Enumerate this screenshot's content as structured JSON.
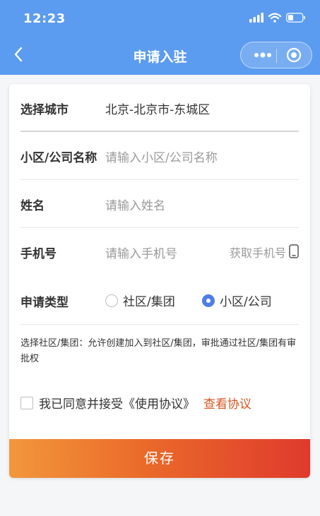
{
  "status": {
    "time": "12:23"
  },
  "nav": {
    "title": "申请入驻"
  },
  "form": {
    "city": {
      "label": "选择城市",
      "value": "北京-北京市-东城区"
    },
    "community": {
      "label": "小区/公司名称",
      "placeholder": "请输入小区/公司名称"
    },
    "name": {
      "label": "姓名",
      "placeholder": "请输入姓名"
    },
    "phone": {
      "label": "手机号",
      "placeholder": "请输入手机号",
      "get_button": "获取手机号"
    },
    "type": {
      "label": "申请类型",
      "options": [
        "社区/集团",
        "小区/公司"
      ],
      "selected": "小区/公司"
    },
    "note": "选择社区/集团：允许创建加入到社区/集团，审批通过社区/集团有审批权",
    "agreement": {
      "text": "我已同意并接受《使用协议》",
      "link": "查看协议",
      "checked": false
    },
    "save_label": "保存"
  },
  "colors": {
    "nav_bg": "#5b9bf0",
    "accent": "#4e7fe6",
    "link": "#d9541e",
    "save_from": "#f2973c",
    "save_to": "#df3a2d"
  },
  "icons": [
    "back-arrow-icon",
    "more-dots-icon",
    "target-icon",
    "signal-icon",
    "wifi-icon",
    "battery-icon",
    "phone-icon"
  ]
}
